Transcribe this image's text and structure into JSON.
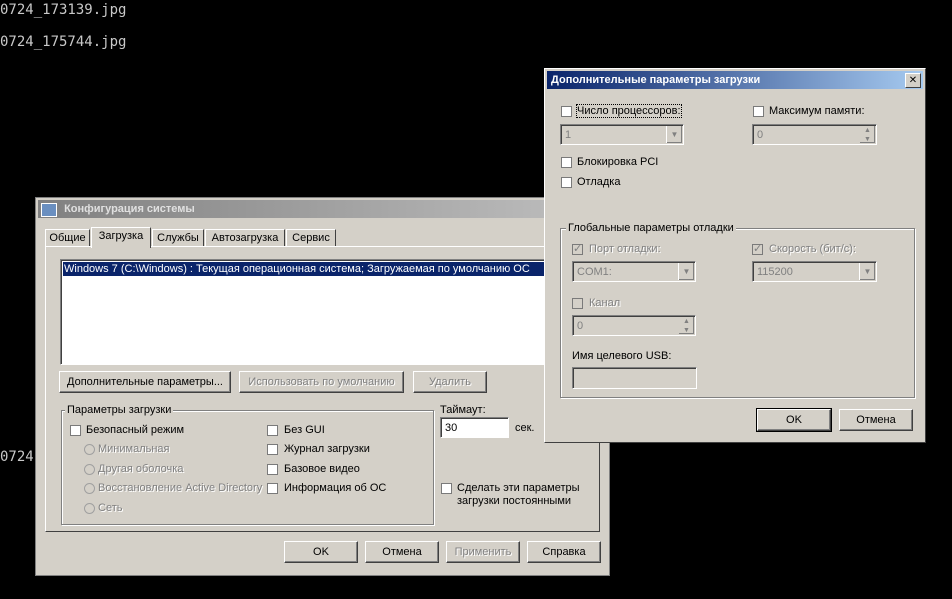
{
  "terminal": {
    "line1": "0724_173139.jpg",
    "line2": "0724_175744.jpg",
    "line3": "0724"
  },
  "syscfg": {
    "title": "Конфигурация системы",
    "tabs": [
      "Общие",
      "Загрузка",
      "Службы",
      "Автозагрузка",
      "Сервис"
    ],
    "boot_entry": "Windows 7 (C:\\Windows) : Текущая операционная система; Загружаемая по умолчанию ОС",
    "btn_advanced": "Дополнительные параметры...",
    "btn_default": "Использовать по умолчанию",
    "btn_delete": "Удалить",
    "boot_group_title": "Параметры загрузки",
    "safe_mode": "Безопасный режим",
    "minimal": "Минимальная",
    "alt_shell": "Другая оболочка",
    "ad_repair": "Восстановление Active Directory",
    "network": "Сеть",
    "no_gui": "Без GUI",
    "boot_log": "Журнал загрузки",
    "base_video": "Базовое видео",
    "os_info": "Информация  об ОС",
    "timeout_label": "Таймаут:",
    "timeout_value": "30",
    "timeout_unit": "сек.",
    "make_permanent": "Сделать эти параметры загрузки постоянными",
    "ok": "OK",
    "cancel": "Отмена",
    "apply": "Применить",
    "help": "Справка"
  },
  "advanced": {
    "title": "Дополнительные параметры загрузки",
    "num_processors": "Число процессоров:",
    "num_processors_value": "1",
    "max_memory": "Максимум памяти:",
    "max_memory_value": "0",
    "pci_lock": "Блокировка PCI",
    "debug": "Отладка",
    "debug_group_title": "Глобальные параметры отладки",
    "debug_port": "Порт отладки:",
    "debug_port_value": "COM1:",
    "baud_rate": "Скорость (бит/с):",
    "baud_rate_value": "115200",
    "channel": "Канал",
    "channel_value": "0",
    "usb_target": "Имя целевого USB:",
    "usb_target_value": "",
    "ok": "OK",
    "cancel": "Отмена",
    "close_glyph": "✕"
  }
}
